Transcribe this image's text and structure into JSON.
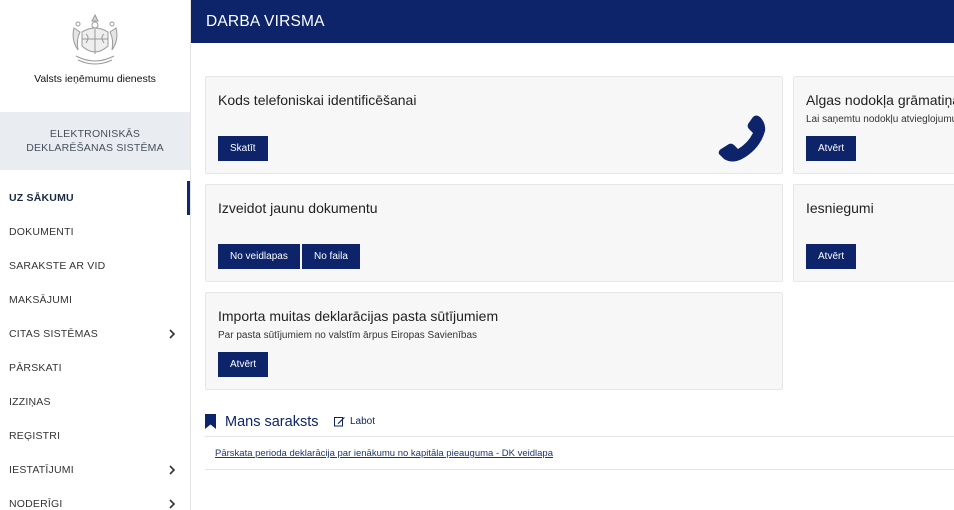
{
  "sidebar": {
    "org_name": "Valsts ieņēmumu dienests",
    "system_name_line1": "ELEKTRONISKĀS",
    "system_name_line2": "DEKLARĒŠANAS SISTĒMA",
    "items": [
      {
        "label": "UZ SĀKUMU",
        "active": true,
        "has_submenu": false
      },
      {
        "label": "DOKUMENTI",
        "active": false,
        "has_submenu": false
      },
      {
        "label": "SARAKSTE AR VID",
        "active": false,
        "has_submenu": false
      },
      {
        "label": "MAKSĀJUMI",
        "active": false,
        "has_submenu": false
      },
      {
        "label": "CITAS SISTĒMAS",
        "active": false,
        "has_submenu": true
      },
      {
        "label": "PĀRSKATI",
        "active": false,
        "has_submenu": false
      },
      {
        "label": "IZZIŅAS",
        "active": false,
        "has_submenu": false
      },
      {
        "label": "REĢISTRI",
        "active": false,
        "has_submenu": false
      },
      {
        "label": "IESTATĪJUMI",
        "active": false,
        "has_submenu": true
      },
      {
        "label": "NODERĪGI",
        "active": false,
        "has_submenu": true
      }
    ]
  },
  "header": {
    "title": "DARBA VIRSMA"
  },
  "cards": {
    "phone_id": {
      "title": "Kods telefoniskai identificēšanai",
      "button": "Skatīt",
      "icon": "phone-icon"
    },
    "tax_book": {
      "title": "Algas nodokļa grāmatiņa",
      "subtitle": "Lai saņemtu nodokļu atvieglojumu",
      "button": "Atvērt"
    },
    "new_doc": {
      "title": "Izveidot jaunu dokumentu",
      "button_template": "No veidlapas",
      "button_file": "No faila"
    },
    "submissions": {
      "title": "Iesniegumi",
      "button": "Atvērt"
    },
    "customs": {
      "title": "Importa muitas deklarācijas pasta sūtījumiem",
      "subtitle": "Par pasta sūtījumiem no valstīm ārpus Eiropas Savienības",
      "button": "Atvērt"
    }
  },
  "my_list": {
    "title": "Mans saraksts",
    "edit_label": "Labot",
    "items": [
      "Pārskata perioda deklarācija par ienākumu no kapitāla pieauguma - DK veidlapa"
    ]
  },
  "colors": {
    "brand": "#0d246a",
    "card_bg": "#f7f7f8",
    "sidebar_system_bg": "#e9ecf0"
  }
}
